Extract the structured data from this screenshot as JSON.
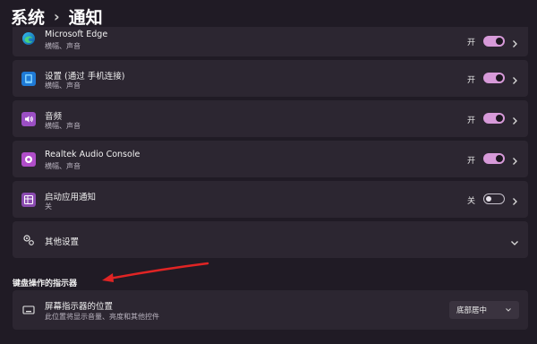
{
  "breadcrumb": {
    "parent": "系统",
    "separator": "›",
    "current": "通知"
  },
  "colors": {
    "accent": "#d79ad9",
    "arrow": "#e02424",
    "card": "#2c2631",
    "background": "#201b25"
  },
  "notification_apps": [
    {
      "title": "Microsoft Edge",
      "subtitle": "横幅、声音",
      "state": "开",
      "enabled": true,
      "icon": "edge-icon"
    },
    {
      "title": "设置 (通过 手机连接)",
      "subtitle": "横幅、声音",
      "state": "开",
      "enabled": true,
      "icon": "settings-app-icon"
    },
    {
      "title": "音频",
      "subtitle": "横幅、声音",
      "state": "开",
      "enabled": true,
      "icon": "audio-icon"
    },
    {
      "title": "Realtek Audio Console",
      "subtitle": "横幅、声音",
      "state": "开",
      "enabled": true,
      "icon": "realtek-icon"
    },
    {
      "title": "启动应用通知",
      "subtitle": "关",
      "state": "关",
      "enabled": false,
      "icon": "startup-app-icon"
    }
  ],
  "other_settings": {
    "label": "其他设置",
    "icon": "gears-icon"
  },
  "section": {
    "title": "键盘操作的指示器"
  },
  "indicator_position": {
    "title": "屏幕指示器的位置",
    "subtitle": "此位置将显示音量、亮度和其他控件",
    "selected": "底部居中",
    "icon": "screen-indicator-icon"
  }
}
